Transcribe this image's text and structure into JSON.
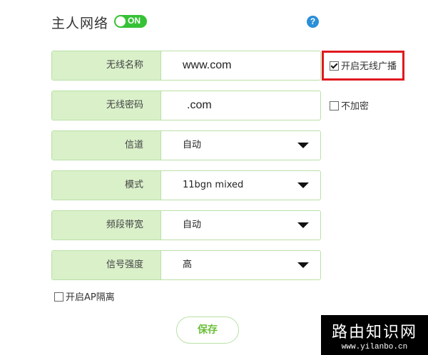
{
  "header": {
    "title": "主人网络",
    "toggle_label": "ON",
    "help_label": "?"
  },
  "fields": [
    {
      "label": "无线名称",
      "value": "www.com"
    },
    {
      "label": "无线密码",
      "value": ".com"
    },
    {
      "label": "信道",
      "value": "自动"
    },
    {
      "label": "模式",
      "value": "11bgn mixed"
    },
    {
      "label": "频段带宽",
      "value": "自动"
    },
    {
      "label": "信号强度",
      "value": "高"
    }
  ],
  "options": {
    "broadcast_label": "开启无线广播",
    "no_encrypt_label": "不加密",
    "ap_isolation_label": "开启AP隔离"
  },
  "actions": {
    "save_label": "保存"
  },
  "watermark": {
    "cn": "路由知识网",
    "en": "www.yilanbo.cn"
  },
  "colors": {
    "accent": "#36c236",
    "label_bg": "#d9f0c9",
    "border": "#b9e0a5",
    "highlight": "#e0191f"
  }
}
